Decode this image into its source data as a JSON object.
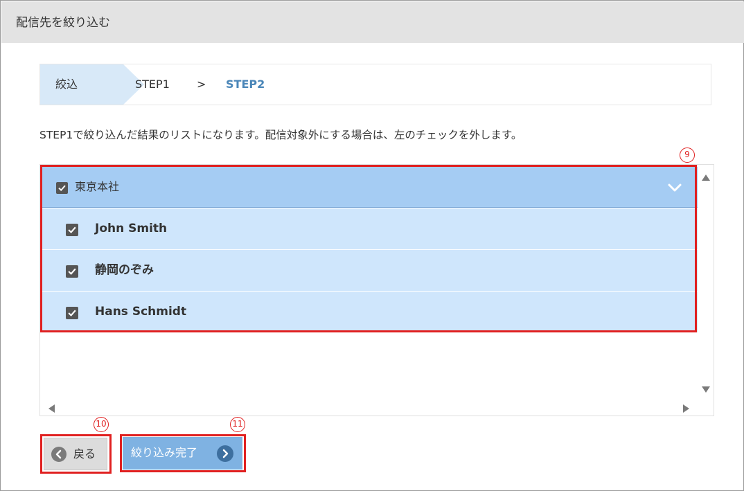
{
  "panel": {
    "title": "配信先を絞り込む"
  },
  "breadcrumb": {
    "filter_label": "絞込",
    "step1": "STEP1",
    "separator": ">",
    "step2": "STEP2"
  },
  "instruction": "STEP1で絞り込んだ結果のリストになります。配信対象外にする場合は、左のチェックを外します。",
  "list": {
    "group": {
      "label": "東京本社",
      "checked": true,
      "icon": "chevron-down-icon"
    },
    "members": [
      {
        "name": "John Smith",
        "checked": true
      },
      {
        "name": "静岡のぞみ",
        "checked": true
      },
      {
        "name": "Hans Schmidt",
        "checked": true
      }
    ]
  },
  "buttons": {
    "back_label": "戻る",
    "complete_label": "絞り込み完了"
  },
  "annotations": {
    "marker_list": "9",
    "marker_back": "10",
    "marker_complete": "11"
  },
  "colors": {
    "accent": "#4a86b8",
    "highlight": "#e02020",
    "group_header": "#a5ccf3",
    "row_bg": "#cfe6fc",
    "complete_button": "#7fb2e2"
  }
}
